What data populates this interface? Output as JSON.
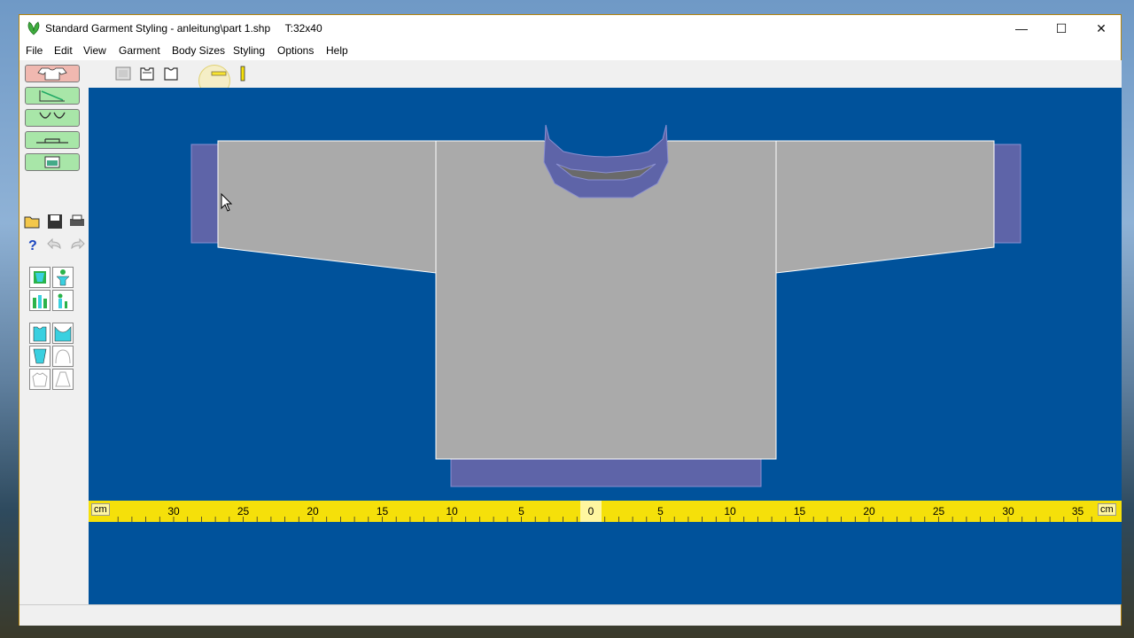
{
  "window": {
    "title": "Standard Garment Styling - anleitung\\part 1.shp",
    "size_label": "T:32x40",
    "minimize": "—",
    "maximize": "☐",
    "close": "✕"
  },
  "menu": [
    "File",
    "Edit",
    "View",
    "Garment",
    "Body Sizes",
    "Styling",
    "Options",
    "Help"
  ],
  "ruler": {
    "unit": "cm",
    "labels": [
      "30",
      "25",
      "20",
      "15",
      "10",
      "5",
      "0",
      "5",
      "10",
      "15",
      "20",
      "25",
      "30",
      "35"
    ]
  },
  "colors": {
    "canvas": "#00529b",
    "garment": "#aaaaaa",
    "rib": "#5e64a8",
    "ruler": "#f5e00a"
  }
}
